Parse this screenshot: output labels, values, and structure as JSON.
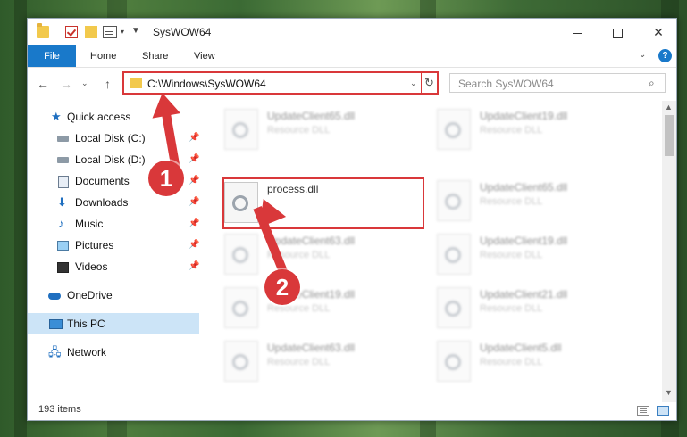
{
  "window": {
    "title": "SysWOW64"
  },
  "ribbon": {
    "tabs": [
      "File",
      "Home",
      "Share",
      "View"
    ]
  },
  "address": {
    "path": "C:\\Windows\\SysWOW64"
  },
  "search": {
    "placeholder": "Search SysWOW64"
  },
  "sidebar": {
    "items": [
      {
        "label": "Quick access",
        "icon": "star-icon",
        "pinned": false
      },
      {
        "label": "Local Disk (C:)",
        "icon": "disk-icon",
        "pinned": true
      },
      {
        "label": "Local Disk (D:)",
        "icon": "disk-icon",
        "pinned": true
      },
      {
        "label": "Documents",
        "icon": "documents-icon",
        "pinned": true
      },
      {
        "label": "Downloads",
        "icon": "download-icon",
        "pinned": true
      },
      {
        "label": "Music",
        "icon": "music-icon",
        "pinned": true
      },
      {
        "label": "Pictures",
        "icon": "pictures-icon",
        "pinned": true
      },
      {
        "label": "Videos",
        "icon": "videos-icon",
        "pinned": true
      },
      {
        "label": "OneDrive",
        "icon": "cloud-icon",
        "pinned": false
      },
      {
        "label": "This PC",
        "icon": "computer-icon",
        "pinned": false,
        "selected": true
      },
      {
        "label": "Network",
        "icon": "network-icon",
        "pinned": false
      }
    ]
  },
  "files": {
    "left": [
      {
        "name": "UpdateClient65.dll",
        "type": "Resource DLL"
      },
      {
        "name": "process.dll",
        "type": ""
      },
      {
        "name": "UpdateClient63.dll",
        "type": "Resource DLL"
      },
      {
        "name": "UpdateClient19.dll",
        "type": "Resource DLL"
      },
      {
        "name": "UpdateClient63.dll",
        "type": "Resource DLL"
      }
    ],
    "right": [
      {
        "name": "UpdateClient19.dll",
        "type": "Resource DLL"
      },
      {
        "name": "UpdateClient65.dll",
        "type": "Resource DLL"
      },
      {
        "name": "UpdateClient19.dll",
        "type": "Resource DLL"
      },
      {
        "name": "UpdateClient21.dll",
        "type": "Resource DLL"
      },
      {
        "name": "UpdateClient5.dll",
        "type": "Resource DLL"
      }
    ]
  },
  "status": {
    "item_count": "193 items"
  },
  "annotations": {
    "badge1": "1",
    "badge2": "2"
  },
  "colors": {
    "accent": "#1979ca",
    "annotation": "#d9383a",
    "selection": "#cce4f7"
  }
}
